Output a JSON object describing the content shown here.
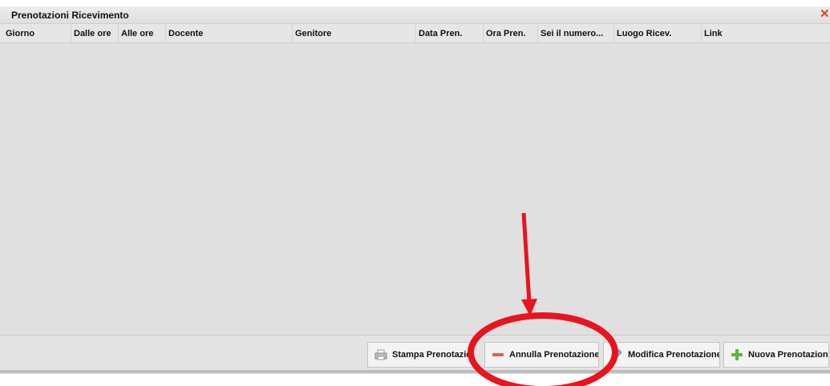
{
  "window": {
    "title": "Prenotazioni Ricevimento",
    "close_symbol": "✕"
  },
  "table": {
    "columns": [
      "Giorno",
      "Dalle ore",
      "Alle ore",
      "Docente",
      "Genitore",
      "Data Pren.",
      "Ora Pren.",
      "Sei il numero...",
      "Luogo Ricev.",
      "Link"
    ],
    "rows": []
  },
  "toolbar": {
    "print_label": "Stampa Prenotazion",
    "cancel_label": "Annulla Prenotazione",
    "edit_label": "Modifica Prenotazione",
    "new_label": "Nuova Prenotazione"
  },
  "icons": {
    "print": "printer-icon",
    "cancel": "minus-icon",
    "edit": "pencil-icon",
    "new": "plus-icon",
    "close": "close-icon"
  },
  "colors": {
    "annotation": "#e8141e",
    "minus": "#e85a4f",
    "plus": "#5cb83c",
    "close": "#e2451e"
  }
}
